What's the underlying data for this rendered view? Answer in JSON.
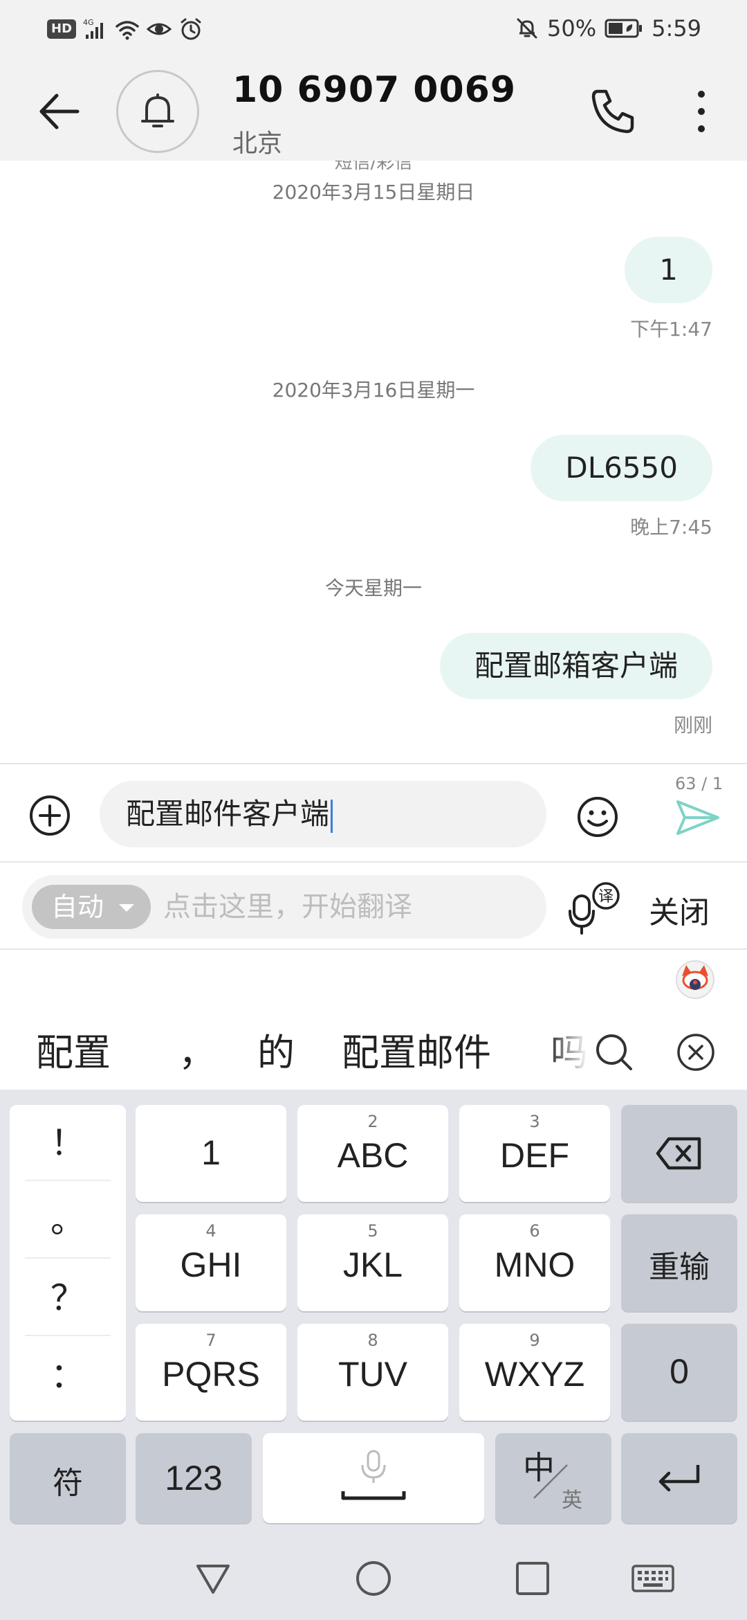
{
  "status_bar": {
    "hd": "HD",
    "network": "4G",
    "battery_percent": "50%",
    "time": "5:59",
    "icons": [
      "hd-icon",
      "signal-icon",
      "wifi-icon",
      "eye-icon",
      "alarm-icon",
      "mute-icon",
      "battery-icon"
    ]
  },
  "header": {
    "contact_name": "10 6907 0069",
    "contact_location": "北京",
    "icons": [
      "back-arrow-icon",
      "bell-icon",
      "phone-icon",
      "more-vertical-icon"
    ]
  },
  "messages": {
    "partial_label": "短信/彩信",
    "items": [
      {
        "date": "2020年3月15日星期日",
        "text": "1",
        "time": "下午1:47"
      },
      {
        "date": "2020年3月16日星期一",
        "text": "DL6550",
        "time": "晚上7:45"
      },
      {
        "date": "今天星期一",
        "text": "配置邮箱客户端",
        "time": "刚刚"
      }
    ]
  },
  "compose": {
    "value": "配置邮件客户端",
    "char_count": "63 / 1",
    "accent_color": "#7dd3c6"
  },
  "translate": {
    "mode": "自动",
    "placeholder": "点击这里，开始翻译",
    "badge": "译",
    "close_label": "关闭"
  },
  "ime": {
    "candidates": [
      "配置",
      "，",
      "的",
      "配置邮件",
      "吗"
    ]
  },
  "keyboard": {
    "punctuation": [
      "！",
      "。",
      "？",
      "："
    ],
    "keys": [
      {
        "num": "",
        "label": "1"
      },
      {
        "num": "2",
        "label": "ABC"
      },
      {
        "num": "3",
        "label": "DEF"
      },
      {
        "num": "4",
        "label": "GHI"
      },
      {
        "num": "5",
        "label": "JKL"
      },
      {
        "num": "6",
        "label": "MNO"
      },
      {
        "num": "7",
        "label": "PQRS"
      },
      {
        "num": "8",
        "label": "TUV"
      },
      {
        "num": "9",
        "label": "WXYZ"
      }
    ],
    "reset_label": "重输",
    "zero_label": "0",
    "symbol_label": "符",
    "numeric_label": "123",
    "lang_main": "中",
    "lang_sub": "英"
  }
}
